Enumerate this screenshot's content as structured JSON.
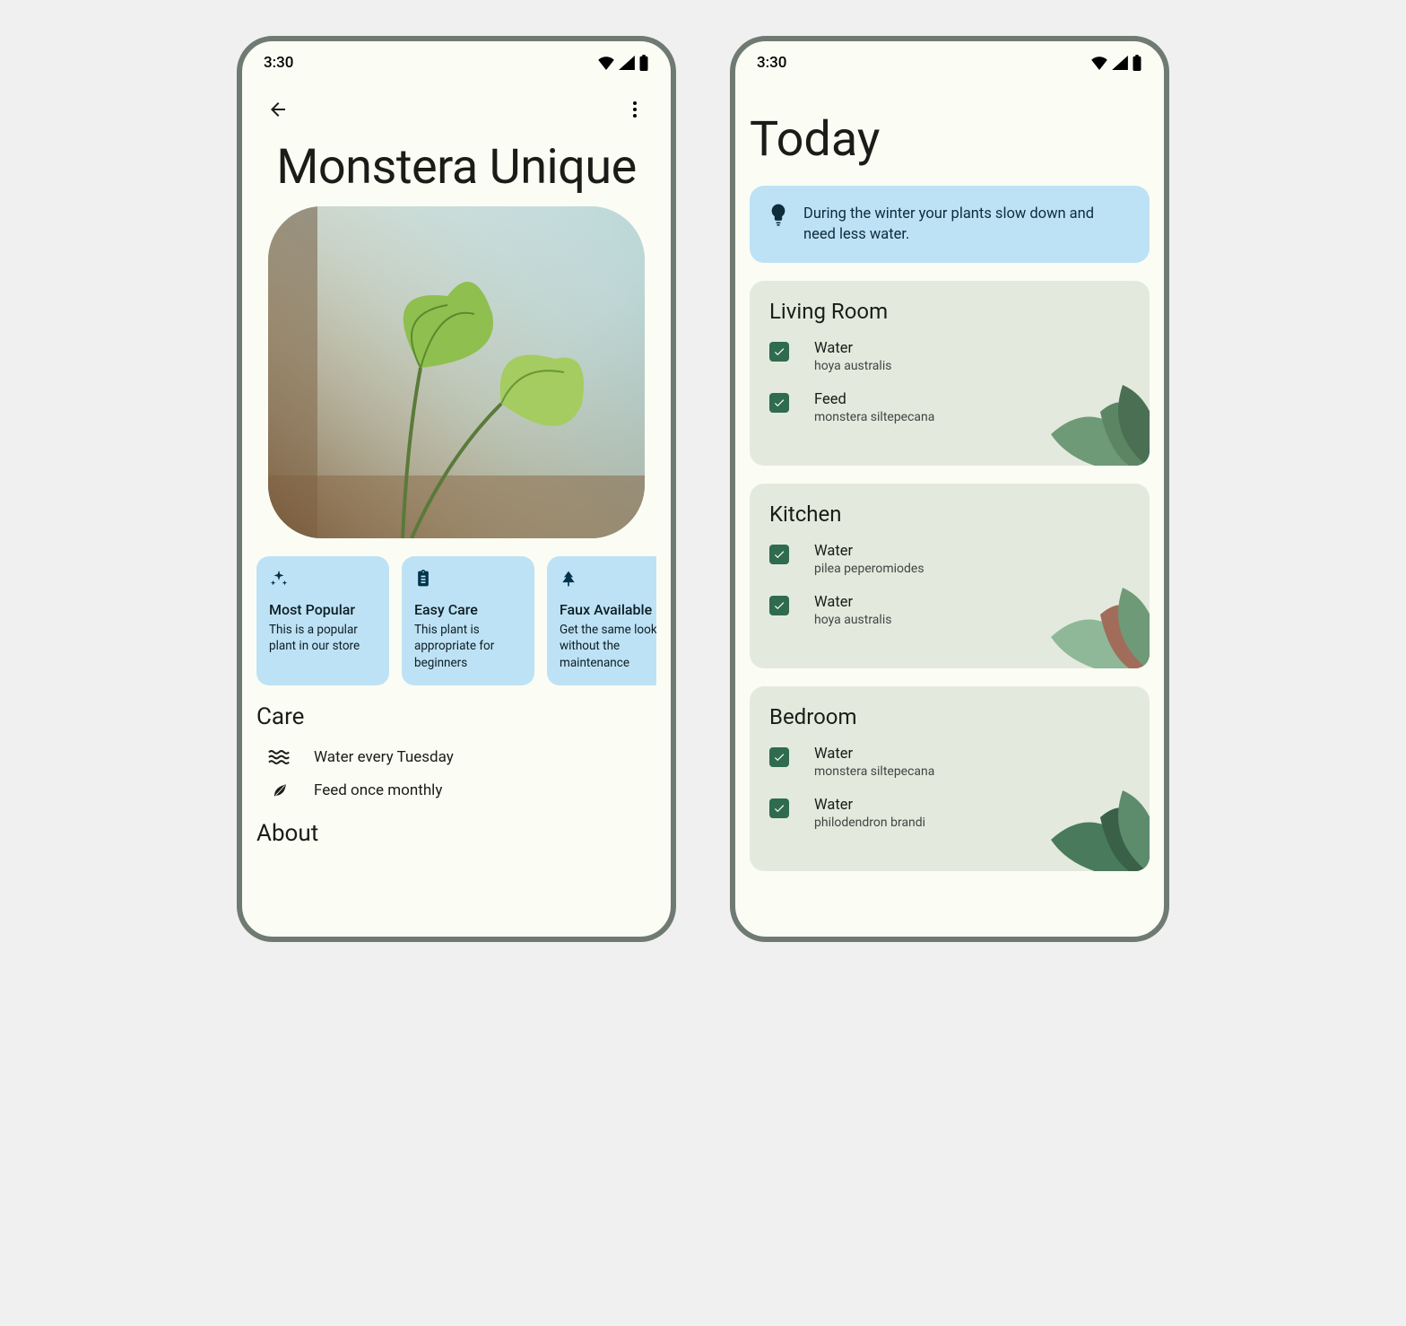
{
  "status": {
    "time": "3:30"
  },
  "detail": {
    "title": "Monstera Unique",
    "chips": [
      {
        "icon": "sparkle",
        "title": "Most Popular",
        "desc": "This is a popular plant in our store"
      },
      {
        "icon": "clipboard",
        "title": "Easy Care",
        "desc": "This plant is appropriate for beginners"
      },
      {
        "icon": "tree",
        "title": "Faux Available",
        "desc": "Get the same look without the maintenance"
      }
    ],
    "care_heading": "Care",
    "care": [
      {
        "icon": "water",
        "text": "Water every Tuesday"
      },
      {
        "icon": "leaf",
        "text": "Feed once monthly"
      }
    ],
    "about_heading": "About"
  },
  "today": {
    "title": "Today",
    "tip": "During the winter your plants slow down and need less water.",
    "rooms": [
      {
        "name": "Living Room",
        "tasks": [
          {
            "action": "Water",
            "plant": "hoya australis",
            "checked": true
          },
          {
            "action": "Feed",
            "plant": "monstera siltepecana",
            "checked": true
          }
        ]
      },
      {
        "name": "Kitchen",
        "tasks": [
          {
            "action": "Water",
            "plant": "pilea peperomiodes",
            "checked": true
          },
          {
            "action": "Water",
            "plant": "hoya australis",
            "checked": true
          }
        ]
      },
      {
        "name": "Bedroom",
        "tasks": [
          {
            "action": "Water",
            "plant": "monstera siltepecana",
            "checked": true
          },
          {
            "action": "Water",
            "plant": "philodendron brandi",
            "checked": true
          }
        ]
      }
    ]
  }
}
